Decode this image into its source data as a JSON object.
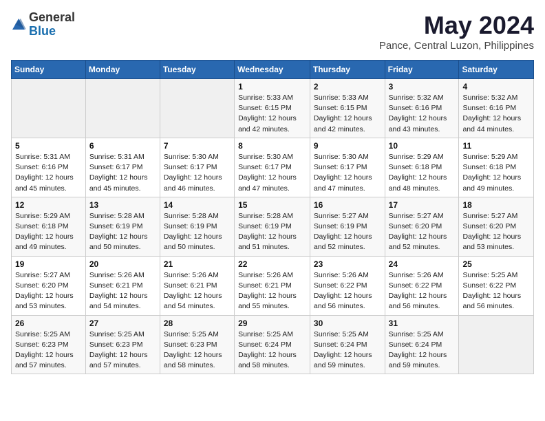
{
  "logo": {
    "text_general": "General",
    "text_blue": "Blue"
  },
  "title": "May 2024",
  "subtitle": "Pance, Central Luzon, Philippines",
  "days_header": [
    "Sunday",
    "Monday",
    "Tuesday",
    "Wednesday",
    "Thursday",
    "Friday",
    "Saturday"
  ],
  "weeks": [
    [
      {
        "day": "",
        "info": ""
      },
      {
        "day": "",
        "info": ""
      },
      {
        "day": "",
        "info": ""
      },
      {
        "day": "1",
        "info": "Sunrise: 5:33 AM\nSunset: 6:15 PM\nDaylight: 12 hours\nand 42 minutes."
      },
      {
        "day": "2",
        "info": "Sunrise: 5:33 AM\nSunset: 6:15 PM\nDaylight: 12 hours\nand 42 minutes."
      },
      {
        "day": "3",
        "info": "Sunrise: 5:32 AM\nSunset: 6:16 PM\nDaylight: 12 hours\nand 43 minutes."
      },
      {
        "day": "4",
        "info": "Sunrise: 5:32 AM\nSunset: 6:16 PM\nDaylight: 12 hours\nand 44 minutes."
      }
    ],
    [
      {
        "day": "5",
        "info": "Sunrise: 5:31 AM\nSunset: 6:16 PM\nDaylight: 12 hours\nand 45 minutes."
      },
      {
        "day": "6",
        "info": "Sunrise: 5:31 AM\nSunset: 6:17 PM\nDaylight: 12 hours\nand 45 minutes."
      },
      {
        "day": "7",
        "info": "Sunrise: 5:30 AM\nSunset: 6:17 PM\nDaylight: 12 hours\nand 46 minutes."
      },
      {
        "day": "8",
        "info": "Sunrise: 5:30 AM\nSunset: 6:17 PM\nDaylight: 12 hours\nand 47 minutes."
      },
      {
        "day": "9",
        "info": "Sunrise: 5:30 AM\nSunset: 6:17 PM\nDaylight: 12 hours\nand 47 minutes."
      },
      {
        "day": "10",
        "info": "Sunrise: 5:29 AM\nSunset: 6:18 PM\nDaylight: 12 hours\nand 48 minutes."
      },
      {
        "day": "11",
        "info": "Sunrise: 5:29 AM\nSunset: 6:18 PM\nDaylight: 12 hours\nand 49 minutes."
      }
    ],
    [
      {
        "day": "12",
        "info": "Sunrise: 5:29 AM\nSunset: 6:18 PM\nDaylight: 12 hours\nand 49 minutes."
      },
      {
        "day": "13",
        "info": "Sunrise: 5:28 AM\nSunset: 6:19 PM\nDaylight: 12 hours\nand 50 minutes."
      },
      {
        "day": "14",
        "info": "Sunrise: 5:28 AM\nSunset: 6:19 PM\nDaylight: 12 hours\nand 50 minutes."
      },
      {
        "day": "15",
        "info": "Sunrise: 5:28 AM\nSunset: 6:19 PM\nDaylight: 12 hours\nand 51 minutes."
      },
      {
        "day": "16",
        "info": "Sunrise: 5:27 AM\nSunset: 6:19 PM\nDaylight: 12 hours\nand 52 minutes."
      },
      {
        "day": "17",
        "info": "Sunrise: 5:27 AM\nSunset: 6:20 PM\nDaylight: 12 hours\nand 52 minutes."
      },
      {
        "day": "18",
        "info": "Sunrise: 5:27 AM\nSunset: 6:20 PM\nDaylight: 12 hours\nand 53 minutes."
      }
    ],
    [
      {
        "day": "19",
        "info": "Sunrise: 5:27 AM\nSunset: 6:20 PM\nDaylight: 12 hours\nand 53 minutes."
      },
      {
        "day": "20",
        "info": "Sunrise: 5:26 AM\nSunset: 6:21 PM\nDaylight: 12 hours\nand 54 minutes."
      },
      {
        "day": "21",
        "info": "Sunrise: 5:26 AM\nSunset: 6:21 PM\nDaylight: 12 hours\nand 54 minutes."
      },
      {
        "day": "22",
        "info": "Sunrise: 5:26 AM\nSunset: 6:21 PM\nDaylight: 12 hours\nand 55 minutes."
      },
      {
        "day": "23",
        "info": "Sunrise: 5:26 AM\nSunset: 6:22 PM\nDaylight: 12 hours\nand 56 minutes."
      },
      {
        "day": "24",
        "info": "Sunrise: 5:26 AM\nSunset: 6:22 PM\nDaylight: 12 hours\nand 56 minutes."
      },
      {
        "day": "25",
        "info": "Sunrise: 5:25 AM\nSunset: 6:22 PM\nDaylight: 12 hours\nand 56 minutes."
      }
    ],
    [
      {
        "day": "26",
        "info": "Sunrise: 5:25 AM\nSunset: 6:23 PM\nDaylight: 12 hours\nand 57 minutes."
      },
      {
        "day": "27",
        "info": "Sunrise: 5:25 AM\nSunset: 6:23 PM\nDaylight: 12 hours\nand 57 minutes."
      },
      {
        "day": "28",
        "info": "Sunrise: 5:25 AM\nSunset: 6:23 PM\nDaylight: 12 hours\nand 58 minutes."
      },
      {
        "day": "29",
        "info": "Sunrise: 5:25 AM\nSunset: 6:24 PM\nDaylight: 12 hours\nand 58 minutes."
      },
      {
        "day": "30",
        "info": "Sunrise: 5:25 AM\nSunset: 6:24 PM\nDaylight: 12 hours\nand 59 minutes."
      },
      {
        "day": "31",
        "info": "Sunrise: 5:25 AM\nSunset: 6:24 PM\nDaylight: 12 hours\nand 59 minutes."
      },
      {
        "day": "",
        "info": ""
      }
    ]
  ]
}
